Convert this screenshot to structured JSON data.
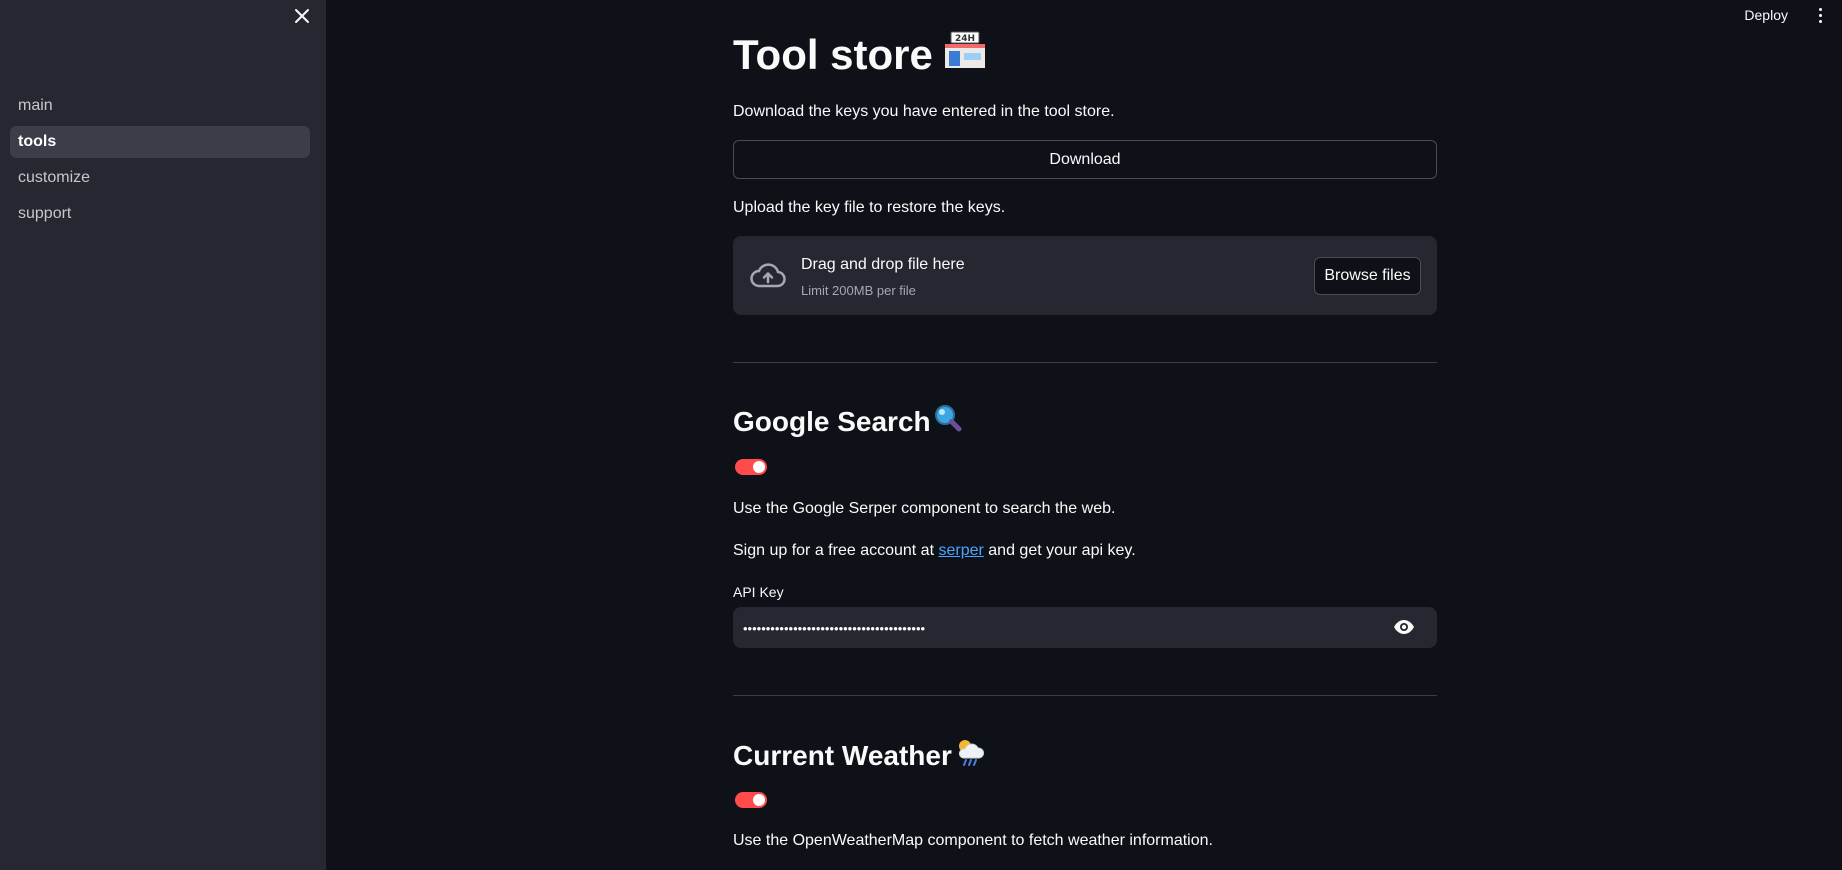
{
  "sidebar": {
    "close_icon": "close-icon",
    "items": [
      {
        "label": "main",
        "active": false
      },
      {
        "label": "tools",
        "active": true
      },
      {
        "label": "customize",
        "active": false
      },
      {
        "label": "support",
        "active": false
      }
    ]
  },
  "header": {
    "deploy_label": "Deploy",
    "menu_icon": "kebab-menu-icon"
  },
  "main": {
    "title": "Tool store",
    "title_emoji": "convenience-store-24h-icon",
    "download_desc": "Download the keys you have entered in the tool store.",
    "download_label": "Download",
    "upload_desc": "Upload the key file to restore the keys.",
    "uploader": {
      "icon": "cloud-upload-icon",
      "main_text": "Drag and drop file here",
      "sub_text": "Limit 200MB per file",
      "browse_label": "Browse files"
    },
    "sections": [
      {
        "heading": "Google Search",
        "emoji": "magnifying-glass-icon",
        "enabled": true,
        "desc": "Use the Google Serper component to search the web.",
        "signup_prefix": "Sign up for a free account at",
        "signup_link": "serper",
        "signup_suffix": "and get your api key.",
        "api_label": "API Key",
        "api_value": "••••••••••••••••••••••••••••••••••••••••"
      },
      {
        "heading": "Current Weather",
        "emoji": "cloud-rain-sun-icon",
        "enabled": true,
        "desc": "Use the OpenWeatherMap component to fetch weather information."
      }
    ]
  },
  "colors": {
    "background": "#0e1117",
    "sidebar": "#262730",
    "accent": "#ff4b4b",
    "link": "#4da3ff"
  }
}
